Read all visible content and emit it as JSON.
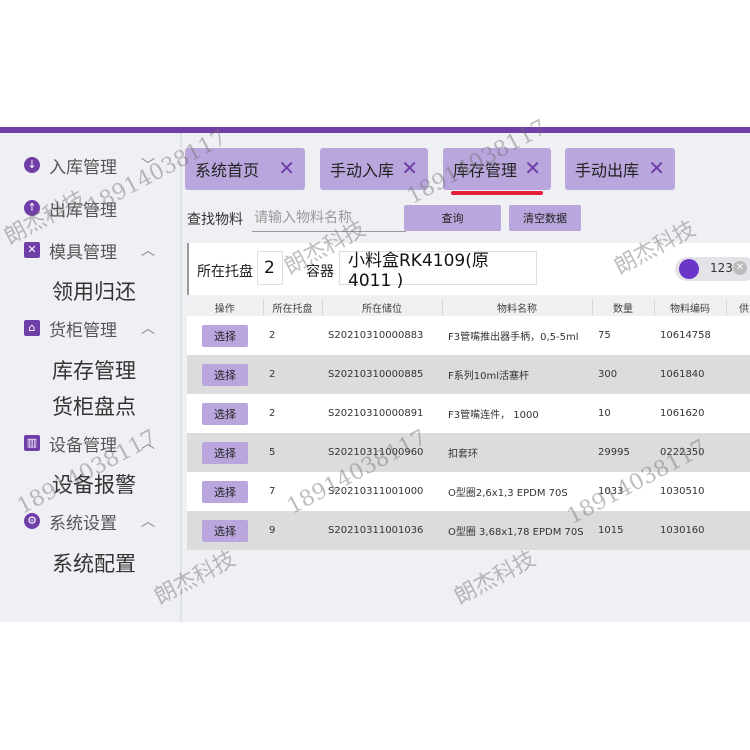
{
  "sidebar": {
    "menus": [
      {
        "label": "入库管理",
        "icon": "arrow-down-circle-icon"
      },
      {
        "label": "出库管理",
        "icon": "arrow-up-circle-icon"
      },
      {
        "label": "模具管理",
        "icon": "tools-icon"
      },
      {
        "label": "货柜管理",
        "icon": "home-icon"
      },
      {
        "label": "设备管理",
        "icon": "device-icon"
      },
      {
        "label": "系统设置",
        "icon": "gear-icon"
      }
    ],
    "sub_items": [
      "领用归还",
      "库存管理",
      "货柜盘点",
      "设备报警",
      "系统配置"
    ]
  },
  "tabs": [
    {
      "label": "系统首页",
      "close": "✕"
    },
    {
      "label": "手动入库",
      "close": "✕"
    },
    {
      "label": "库存管理",
      "close": "✕"
    },
    {
      "label": "手动出库",
      "close": "✕"
    }
  ],
  "search": {
    "label": "查找物料",
    "placeholder": "请输入物料名称",
    "query_button": "查询",
    "clear_button": "清空数据"
  },
  "filter": {
    "tray_label": "所在托盘",
    "tray_value": "2",
    "container_label": "容器",
    "container_value": "小料盒RK4109(原4011 )",
    "toggle_value": "123"
  },
  "table": {
    "headers": [
      "操作",
      "所在托盘",
      "所在储位",
      "物料名称",
      "数量",
      "物料编码",
      "供"
    ],
    "select_label": "选择",
    "rows": [
      {
        "tray": "2",
        "location": "S20210310000883",
        "name": "F3管嘴推出器手柄，0,5-5ml",
        "qty": "75",
        "code": "10614758"
      },
      {
        "tray": "2",
        "location": "S20210310000885",
        "name": "F系列10ml活塞杆",
        "qty": "300",
        "code": "1061840"
      },
      {
        "tray": "2",
        "location": "S20210310000891",
        "name": "F3管嘴连件， 1000",
        "qty": "10",
        "code": "1061620"
      },
      {
        "tray": "5",
        "location": "S20210311000960",
        "name": "扣套环",
        "qty": "29995",
        "code": "0222350"
      },
      {
        "tray": "7",
        "location": "S20210311001000",
        "name": "O型圈2,6x1,3 EPDM 70S",
        "qty": "1033",
        "code": "1030510"
      },
      {
        "tray": "9",
        "location": "S20210311001036",
        "name": "O型圈 3,68x1,78 EPDM 70S",
        "qty": "1015",
        "code": "1030160"
      }
    ]
  },
  "watermarks": [
    "朗杰科技",
    "18914038117"
  ],
  "colors": {
    "accent": "#6f3ea8",
    "tab_bg": "#b9a6dc",
    "active_underline": "#e51e3a"
  }
}
